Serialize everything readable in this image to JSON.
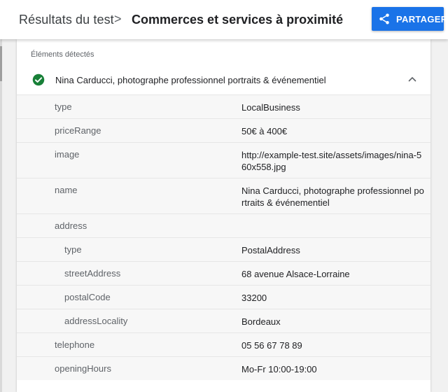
{
  "header": {
    "breadcrumb_prev": "Résultats du test",
    "separator": ">",
    "breadcrumb_current": "Commerces et services à proximité",
    "share_label": "PARTAGER",
    "share_icon": "share-icon",
    "accent_color": "#1a73e8"
  },
  "card": {
    "section_label": "Éléments détectés",
    "item": {
      "status_icon": "check-circle-icon",
      "status_color": "#188038",
      "title": "Nina Carducci, photographe professionnel portraits & événementiel",
      "toggle_icon": "chevron-up-icon"
    },
    "properties": [
      {
        "key": "type",
        "value": "LocalBusiness"
      },
      {
        "key": "priceRange",
        "value": "50€ à 400€"
      },
      {
        "key": "image",
        "value": "http://example-test.site/assets/images/nina-560x558.jpg"
      },
      {
        "key": "name",
        "value": "Nina Carducci, photographe professionnel portraits & événementiel"
      },
      {
        "key": "address",
        "value": ""
      },
      {
        "key": "type",
        "value": "PostalAddress"
      },
      {
        "key": "streetAddress",
        "value": "68 avenue Alsace-Lorraine"
      },
      {
        "key": "postalCode",
        "value": "33200"
      },
      {
        "key": "addressLocality",
        "value": "Bordeaux"
      },
      {
        "key": "telephone",
        "value": "05 56 67 78 89"
      },
      {
        "key": "openingHours",
        "value": "Mo-Fr 10:00-19:00"
      }
    ]
  }
}
